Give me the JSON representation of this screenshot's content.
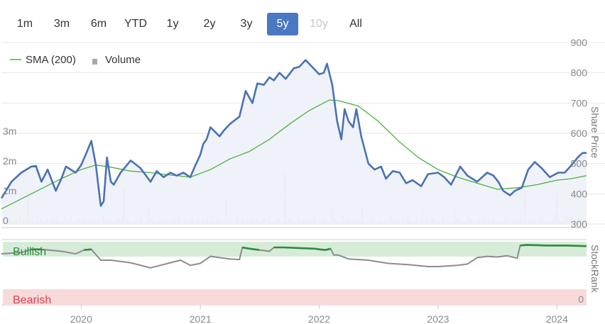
{
  "range_selector": {
    "buttons": [
      {
        "label": "1m",
        "state": "normal"
      },
      {
        "label": "3m",
        "state": "normal"
      },
      {
        "label": "6m",
        "state": "normal"
      },
      {
        "label": "YTD",
        "state": "normal"
      },
      {
        "label": "1y",
        "state": "normal"
      },
      {
        "label": "2y",
        "state": "normal"
      },
      {
        "label": "3y",
        "state": "normal"
      },
      {
        "label": "5y",
        "state": "active"
      },
      {
        "label": "10y",
        "state": "disabled"
      },
      {
        "label": "All",
        "state": "normal"
      }
    ]
  },
  "legend": {
    "sma_label": "SMA (200)",
    "volume_label": "Volume"
  },
  "colors": {
    "price": "#4a72b5",
    "price_fill": "#eef1f8",
    "sma": "#4caf3a",
    "volume": "#c4c4c8",
    "stockrank_bull": "#2e8b3d",
    "stockrank_neutral": "#8c8c8c",
    "bull_band": "#d6ecd8",
    "bear_band": "#f8dadb",
    "bull_text": "#2e8b3d",
    "bear_text": "#d9434e",
    "active_button": "#4a78c2",
    "grid": "#e6e6e6"
  },
  "chart_data": {
    "type": "line",
    "x_range": [
      "2019-05-01",
      "2024-04-01"
    ],
    "x_tick_labels": [
      "2020",
      "2021",
      "2022",
      "2023",
      "2024"
    ],
    "x_ticks": [
      "2020-01-01",
      "2021-01-01",
      "2022-01-01",
      "2023-01-01",
      "2024-01-01"
    ],
    "price_axis": {
      "title": "Share Price",
      "ylim": [
        300,
        900
      ],
      "ticks": [
        300,
        400,
        500,
        600,
        700,
        800,
        900
      ]
    },
    "volume_axis": {
      "ylim": [
        0,
        5
      ],
      "ticks": [
        0,
        1,
        2,
        3
      ],
      "tick_labels": [
        "0",
        "1m",
        "2m",
        "3m"
      ]
    },
    "stockrank_axis": {
      "title": "StockRank",
      "ylim": [
        0,
        100
      ],
      "tick_labels": [
        "0"
      ],
      "bands": {
        "bullish": "Bullish",
        "bearish": "Bearish"
      }
    },
    "series": [
      {
        "name": "Share Price",
        "x": [
          "2019-05-01",
          "2019-06-01",
          "2019-07-01",
          "2019-08-01",
          "2019-08-15",
          "2019-09-01",
          "2019-09-20",
          "2019-10-15",
          "2019-11-01",
          "2019-11-15",
          "2019-12-15",
          "2020-01-01",
          "2020-01-15",
          "2020-02-01",
          "2020-02-15",
          "2020-03-01",
          "2020-03-10",
          "2020-03-20",
          "2020-04-01",
          "2020-04-10",
          "2020-05-01",
          "2020-06-01",
          "2020-07-01",
          "2020-08-01",
          "2020-08-20",
          "2020-09-10",
          "2020-10-01",
          "2020-10-20",
          "2020-11-10",
          "2020-12-01",
          "2020-12-15",
          "2021-01-01",
          "2021-01-10",
          "2021-01-20",
          "2021-02-01",
          "2021-02-15",
          "2021-03-01",
          "2021-03-15",
          "2021-04-01",
          "2021-05-01",
          "2021-05-20",
          "2021-06-10",
          "2021-06-25",
          "2021-07-15",
          "2021-08-01",
          "2021-08-15",
          "2021-09-01",
          "2021-09-20",
          "2021-10-15",
          "2021-11-01",
          "2021-11-20",
          "2021-12-10",
          "2022-01-01",
          "2022-01-15",
          "2022-01-25",
          "2022-02-10",
          "2022-02-25",
          "2022-03-10",
          "2022-03-20",
          "2022-04-01",
          "2022-04-15",
          "2022-04-25",
          "2022-05-10",
          "2022-06-01",
          "2022-06-20",
          "2022-07-10",
          "2022-07-25",
          "2022-08-15",
          "2022-09-05",
          "2022-09-25",
          "2022-10-15",
          "2022-11-10",
          "2022-12-01",
          "2023-01-01",
          "2023-01-20",
          "2023-02-10",
          "2023-03-10",
          "2023-04-01",
          "2023-05-01",
          "2023-06-01",
          "2023-06-20",
          "2023-07-05",
          "2023-07-20",
          "2023-08-10",
          "2023-08-25",
          "2023-09-15",
          "2023-10-05",
          "2023-10-25",
          "2023-11-15",
          "2023-12-10",
          "2024-01-05",
          "2024-01-25",
          "2024-02-15",
          "2024-03-05",
          "2024-03-20",
          "2024-04-01"
        ],
        "values": [
          385,
          440,
          470,
          490,
          492,
          440,
          480,
          410,
          450,
          490,
          470,
          495,
          530,
          575,
          495,
          360,
          375,
          520,
          440,
          430,
          470,
          510,
          485,
          440,
          475,
          455,
          470,
          460,
          470,
          455,
          490,
          530,
          565,
          580,
          620,
          605,
          590,
          610,
          630,
          655,
          740,
          700,
          765,
          760,
          785,
          775,
          800,
          780,
          815,
          820,
          842,
          820,
          795,
          800,
          830,
          760,
          640,
          580,
          680,
          640,
          620,
          680,
          590,
          500,
          480,
          490,
          450,
          475,
          470,
          435,
          445,
          425,
          465,
          470,
          455,
          430,
          490,
          460,
          440,
          470,
          460,
          440,
          410,
          395,
          410,
          420,
          480,
          505,
          485,
          455,
          470,
          470,
          495,
          520,
          535,
          535
        ],
        "color": "#4a72b5"
      },
      {
        "name": "SMA (200)",
        "x": [
          "2019-05-01",
          "2019-08-01",
          "2019-11-01",
          "2020-01-01",
          "2020-02-15",
          "2020-04-01",
          "2020-06-01",
          "2020-08-01",
          "2020-10-01",
          "2020-12-01",
          "2021-02-01",
          "2021-04-01",
          "2021-06-01",
          "2021-08-01",
          "2021-10-01",
          "2021-12-01",
          "2022-02-01",
          "2022-03-01",
          "2022-05-01",
          "2022-07-01",
          "2022-09-01",
          "2022-11-01",
          "2023-01-01",
          "2023-03-01",
          "2023-05-01",
          "2023-07-01",
          "2023-09-01",
          "2023-11-01",
          "2024-01-01",
          "2024-02-15",
          "2024-04-01"
        ],
        "values": [
          350,
          400,
          450,
          480,
          495,
          488,
          475,
          470,
          462,
          455,
          480,
          515,
          540,
          580,
          630,
          675,
          710,
          708,
          690,
          640,
          575,
          520,
          480,
          455,
          435,
          415,
          420,
          430,
          445,
          450,
          460
        ],
        "color": "#4caf3a"
      }
    ],
    "volume": {
      "name": "Volume",
      "values_m": [
        0.05,
        0.1,
        0.2,
        0.15,
        0.1,
        0.08,
        0.2,
        0.06,
        0.3,
        0.1,
        0.15,
        0.08,
        1.1,
        0.2,
        0.1,
        0.15,
        0.06,
        0.3,
        0.1,
        0.2,
        0.08,
        0.1,
        0.2,
        0.06,
        0.1,
        0.15,
        0.3,
        0.1,
        0.2,
        0.08,
        0.06,
        0.1,
        0.2,
        0.15,
        0.1,
        0.3,
        0.08,
        0.1,
        0.06,
        0.2,
        0.1,
        0.15,
        0.3,
        0.1,
        0.2,
        0.06,
        0.08,
        0.15,
        0.1,
        0.2,
        0.1,
        0.06,
        0.3,
        0.1,
        0.15,
        0.08,
        0.2,
        0.1,
        0.06,
        0.1,
        0.2,
        0.15,
        0.3,
        1.2,
        0.1,
        0.2,
        0.08,
        0.06,
        0.1,
        0.15,
        0.2,
        0.1,
        0.3,
        0.08,
        0.06,
        0.1,
        0.55,
        0.2,
        0.15,
        0.1,
        0.06,
        0.08,
        0.3,
        0.1,
        0.2,
        0.15,
        0.1,
        0.06,
        0.08,
        0.1,
        0.2,
        0.15,
        0.3,
        0.1,
        0.06,
        0.2,
        0.08,
        0.1,
        0.15,
        0.3,
        0.1,
        0.06,
        0.2,
        0.1,
        0.08,
        0.15,
        0.1,
        0.2,
        0.06,
        0.3,
        0.1,
        0.15,
        0.08,
        0.2,
        0.1,
        0.06,
        0.1,
        0.8,
        0.15,
        0.2,
        0.08,
        0.06,
        0.1,
        0.3,
        0.15,
        0.1,
        0.2,
        0.06,
        0.08,
        0.1,
        0.15,
        0.3,
        0.1,
        0.2,
        0.06,
        0.08,
        0.1,
        0.15,
        0.2,
        0.1,
        0.3,
        0.06,
        0.08,
        0.1,
        0.2,
        0.15,
        0.1,
        0.06,
        1.75,
        0.1,
        0.2,
        0.15,
        0.08,
        0.06,
        0.1,
        0.3,
        0.2,
        0.1,
        0.15,
        0.06,
        0.08,
        0.2,
        0.1,
        0.15,
        0.3,
        0.06,
        0.1,
        0.08,
        0.2,
        0.15,
        0.1,
        0.06,
        0.1,
        0.5,
        0.2,
        0.15,
        0.1,
        0.08,
        0.06,
        0.3,
        0.1,
        0.2,
        0.15,
        0.06,
        0.08,
        0.1,
        0.2,
        0.15,
        0.1,
        0.6,
        0.06,
        0.08,
        0.1,
        0.2,
        0.15,
        0.3,
        0.1,
        0.06,
        0.08,
        0.2,
        0.1,
        0.15,
        0.06,
        0.1,
        0.3,
        0.08,
        0.2,
        0.1,
        0.15,
        0.06,
        0.1,
        0.2,
        0.08,
        0.3,
        0.15,
        0.1,
        0.06,
        0.1,
        0.2,
        0.08,
        0.15,
        0.6,
        0.1,
        0.3,
        0.06,
        0.1,
        0.2,
        0.15,
        0.08,
        0.1,
        0.06,
        0.2,
        0.3,
        0.1,
        0.15,
        0.08,
        0.06,
        0.1,
        0.55,
        0.2,
        0.1,
        0.15,
        0.06,
        0.08,
        0.1,
        0.3,
        0.2,
        0.15,
        0.1,
        0.06,
        0.08,
        0.2,
        0.1,
        0.15,
        0.3,
        0.06,
        0.1,
        0.08,
        0.2,
        0.15,
        0.1,
        0.06,
        0.1,
        0.2,
        0.08,
        0.3,
        0.15,
        0.1,
        0.06,
        0.1,
        0.2,
        0.08,
        0.15,
        0.3,
        0.1,
        1.35,
        0.06,
        0.1,
        0.2,
        0.15,
        0.08,
        0.1,
        0.06,
        0.2,
        0.3,
        0.1,
        0.15,
        0.08,
        0.06,
        0.1,
        0.2,
        0.4,
        1.0,
        0.15,
        0.06,
        0.08,
        0.1,
        0.3,
        0.2,
        0.15,
        0.1,
        0.06,
        0.08,
        0.2,
        0.1,
        0.15
      ]
    },
    "stockrank": {
      "name": "StockRank",
      "x": [
        "2019-05-01",
        "2019-07-01",
        "2019-08-01",
        "2019-09-01",
        "2019-11-01",
        "2019-12-15",
        "2020-01-10",
        "2020-02-01",
        "2020-03-01",
        "2020-04-01",
        "2020-05-01",
        "2020-06-01",
        "2020-08-01",
        "2020-09-01",
        "2020-10-01",
        "2020-11-01",
        "2020-12-01",
        "2021-01-01",
        "2021-02-01",
        "2021-04-01",
        "2021-05-01",
        "2021-05-10",
        "2021-06-01",
        "2021-07-01",
        "2021-08-01",
        "2021-08-15",
        "2021-09-15",
        "2021-11-01",
        "2021-12-20",
        "2022-01-01",
        "2022-01-20",
        "2022-02-05",
        "2022-02-15",
        "2022-03-01",
        "2022-04-01",
        "2022-06-01",
        "2022-08-01",
        "2022-10-01",
        "2022-12-01",
        "2023-01-01",
        "2023-02-01",
        "2023-03-01",
        "2023-04-01",
        "2023-05-01",
        "2023-06-01",
        "2023-07-01",
        "2023-08-01",
        "2023-09-01",
        "2023-09-10",
        "2023-10-01",
        "2023-12-01",
        "2024-02-01",
        "2024-04-01"
      ],
      "values": [
        80,
        82,
        87,
        87,
        84,
        80,
        86,
        87,
        70,
        70,
        68,
        66,
        58,
        62,
        66,
        70,
        62,
        65,
        76,
        72,
        71,
        90,
        88,
        86,
        84,
        90,
        90,
        89,
        88,
        87,
        86,
        88,
        78,
        78,
        72,
        70,
        65,
        63,
        60,
        60,
        61,
        62,
        64,
        74,
        76,
        75,
        77,
        73,
        93,
        94,
        93,
        93,
        92
      ]
    }
  }
}
